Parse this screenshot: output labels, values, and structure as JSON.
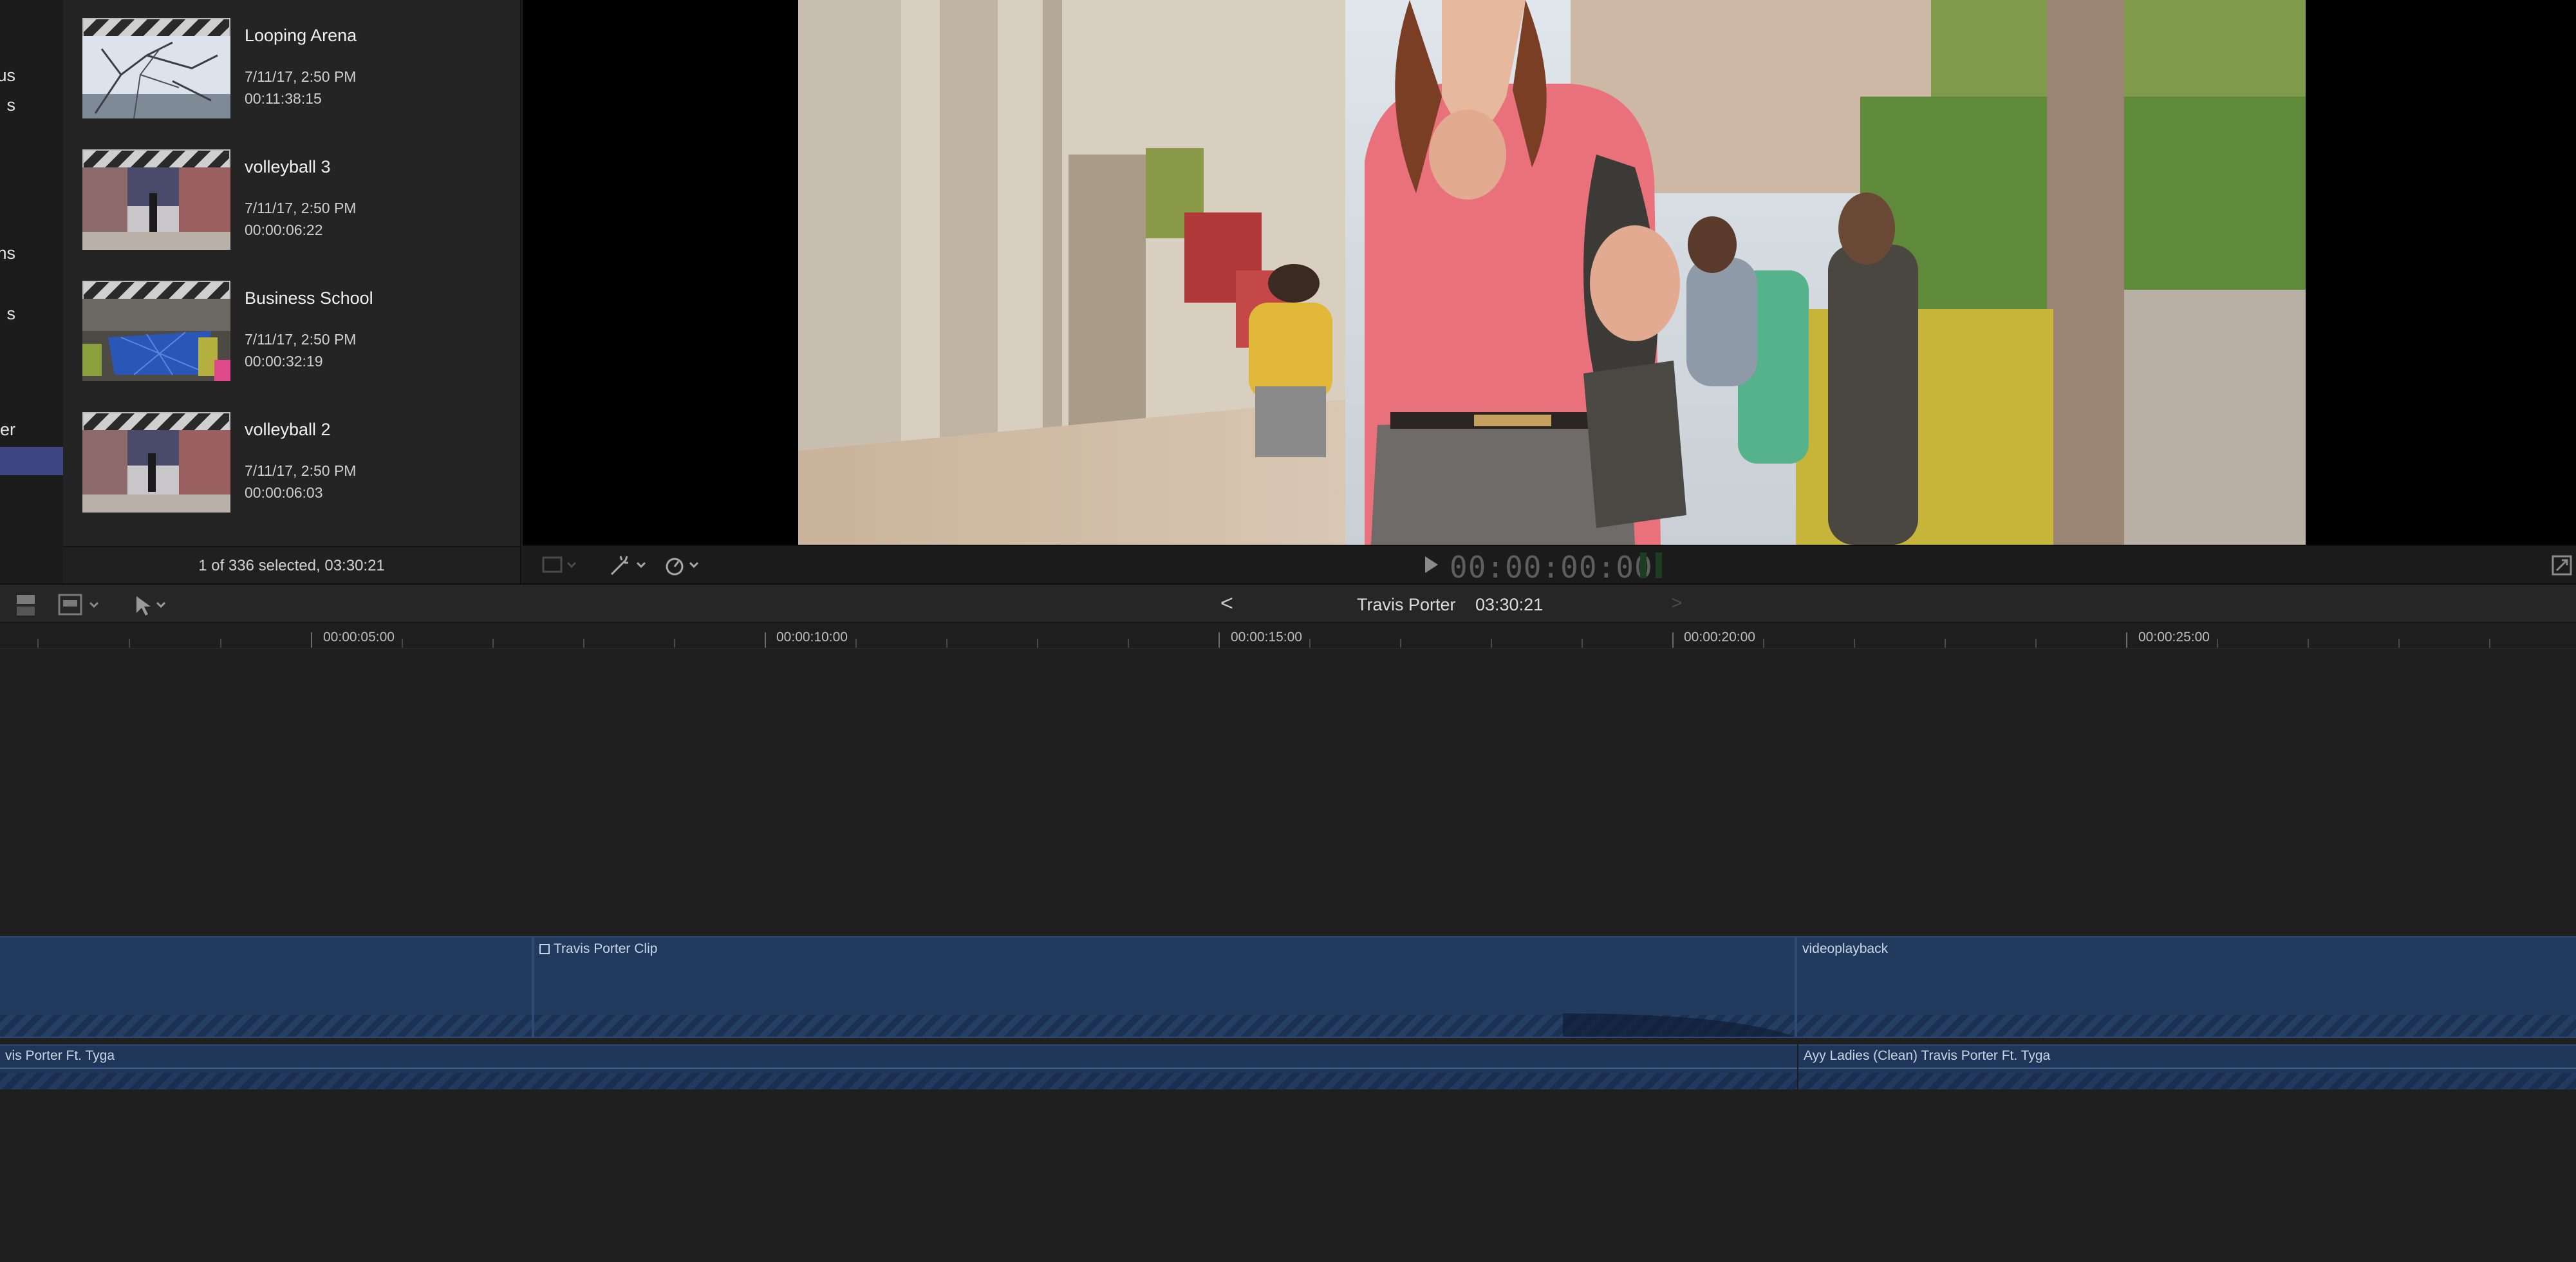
{
  "library": {
    "items": [
      {
        "label": "us"
      },
      {
        "label": "s"
      },
      {
        "label": "ns"
      },
      {
        "label": "s"
      },
      {
        "label": "er"
      }
    ]
  },
  "browser": {
    "clips": [
      {
        "name": "Looping Arena",
        "date": "7/11/17, 2:50 PM",
        "duration": "00:11:38:15"
      },
      {
        "name": "volleyball 3",
        "date": "7/11/17, 2:50 PM",
        "duration": "00:00:06:22"
      },
      {
        "name": "Business School",
        "date": "7/11/17, 2:50 PM",
        "duration": "00:00:32:19"
      },
      {
        "name": "volleyball 2",
        "date": "7/11/17, 2:50 PM",
        "duration": "00:00:06:03"
      }
    ],
    "footer": "1 of 336 selected, 03:30:21"
  },
  "viewer": {
    "timecode": "00:00:00:00"
  },
  "timeline": {
    "back": "<",
    "title": "Travis Porter",
    "duration": "03:30:21",
    "forward": ">",
    "ruler": [
      "00:00:05:00",
      "00:00:10:00",
      "00:00:15:00",
      "00:00:20:00",
      "00:00:25:00"
    ],
    "video_clips": [
      {
        "label": ""
      },
      {
        "label": "Travis Porter Clip"
      },
      {
        "label": "videoplayback"
      }
    ],
    "audio_clips": [
      {
        "label": "vis Porter Ft. Tyga"
      },
      {
        "label": "Ayy Ladies (Clean) Travis Porter Ft. Tyga"
      }
    ]
  },
  "icons": {
    "compound": "compound-clip-icon",
    "play": "play-icon",
    "arrow": "select-arrow-icon"
  }
}
